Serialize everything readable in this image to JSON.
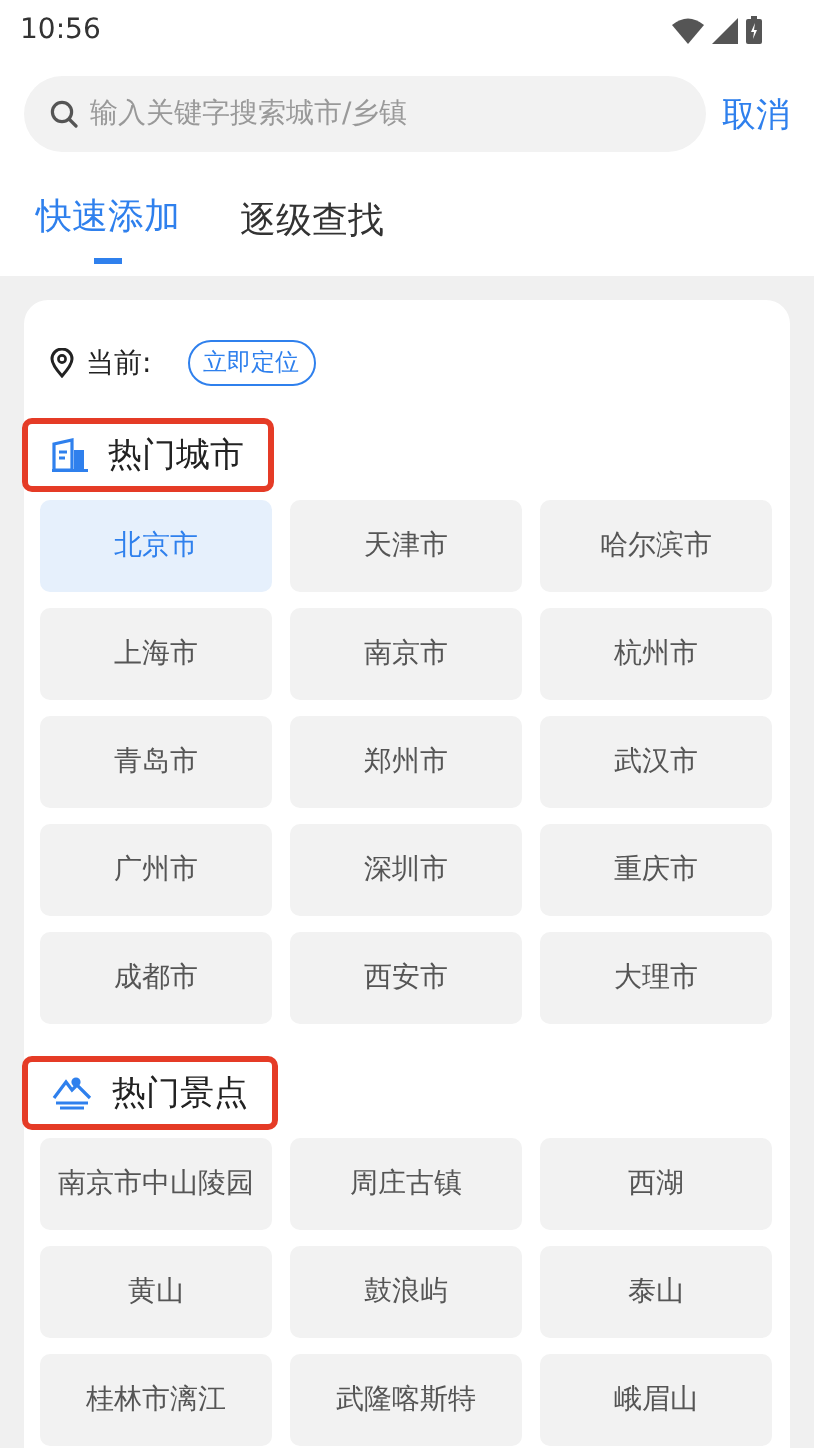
{
  "status_bar": {
    "time": "10:56"
  },
  "search": {
    "placeholder": "输入关键字搜索城市/乡镇",
    "cancel": "取消"
  },
  "tabs": [
    {
      "label": "快速添加",
      "selected": true
    },
    {
      "label": "逐级查找",
      "selected": false
    }
  ],
  "location": {
    "label": "当前:",
    "button": "立即定位"
  },
  "sections": [
    {
      "kind": "city",
      "title": "热门城市",
      "highlighted": true,
      "items": [
        {
          "label": "北京市",
          "selected": true
        },
        {
          "label": "天津市",
          "selected": false
        },
        {
          "label": "哈尔滨市",
          "selected": false
        },
        {
          "label": "上海市",
          "selected": false
        },
        {
          "label": "南京市",
          "selected": false
        },
        {
          "label": "杭州市",
          "selected": false
        },
        {
          "label": "青岛市",
          "selected": false
        },
        {
          "label": "郑州市",
          "selected": false
        },
        {
          "label": "武汉市",
          "selected": false
        },
        {
          "label": "广州市",
          "selected": false
        },
        {
          "label": "深圳市",
          "selected": false
        },
        {
          "label": "重庆市",
          "selected": false
        },
        {
          "label": "成都市",
          "selected": false
        },
        {
          "label": "西安市",
          "selected": false
        },
        {
          "label": "大理市",
          "selected": false
        }
      ]
    },
    {
      "kind": "scenic",
      "title": "热门景点",
      "highlighted": true,
      "items": [
        {
          "label": "南京市中山陵园",
          "selected": false
        },
        {
          "label": "周庄古镇",
          "selected": false
        },
        {
          "label": "西湖",
          "selected": false
        },
        {
          "label": "黄山",
          "selected": false
        },
        {
          "label": "鼓浪屿",
          "selected": false
        },
        {
          "label": "泰山",
          "selected": false
        },
        {
          "label": "桂林市漓江",
          "selected": false
        },
        {
          "label": "武隆喀斯特",
          "selected": false
        },
        {
          "label": "峨眉山",
          "selected": false
        }
      ]
    }
  ]
}
